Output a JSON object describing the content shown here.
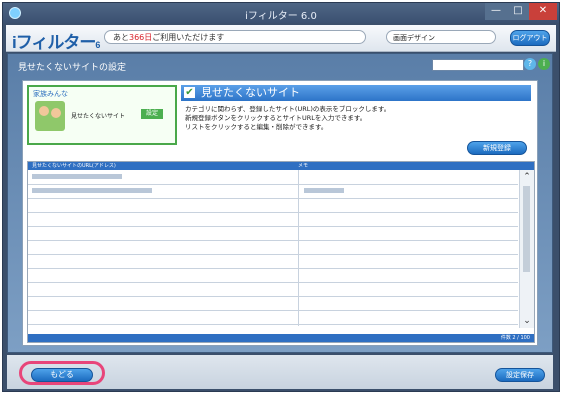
{
  "window": {
    "title": "iフィルター 6.0",
    "controls": {
      "minimize": "—",
      "maximize": "□",
      "close": "✕"
    }
  },
  "toolbar": {
    "logo": "iフィルター",
    "logo_suffix": "6",
    "notice_prefix": "あと",
    "notice_highlight": "366日",
    "notice_suffix": "ご利用いただけます",
    "design_label": "画面デザイン",
    "logout_label": "ログアウト"
  },
  "section": {
    "title": "見せたくないサイトの設定"
  },
  "profile": {
    "name": "家族みんな",
    "label": "見せたくないサイト",
    "button": "設定"
  },
  "info": {
    "heading": "見せたくないサイト",
    "lines": [
      "カテゴリに関わらず、登録したサイト(URL)の表示をブロックします。",
      "新規登録ボタンをクリックするとサイトURLを入力できます。",
      "リストをクリックすると編集・削除ができます。"
    ],
    "new_button": "新規登録"
  },
  "table": {
    "columns": [
      "見せたくないサイトのURL(アドレス)",
      "メモ"
    ],
    "footer": "件数 2 / 100"
  },
  "footer": {
    "back_label": "もどる",
    "apply_label": "設定保存"
  },
  "colors": {
    "accent_blue": "#2f6fc2",
    "highlight_pink": "#e8457a",
    "profile_green": "#4aa84a"
  }
}
